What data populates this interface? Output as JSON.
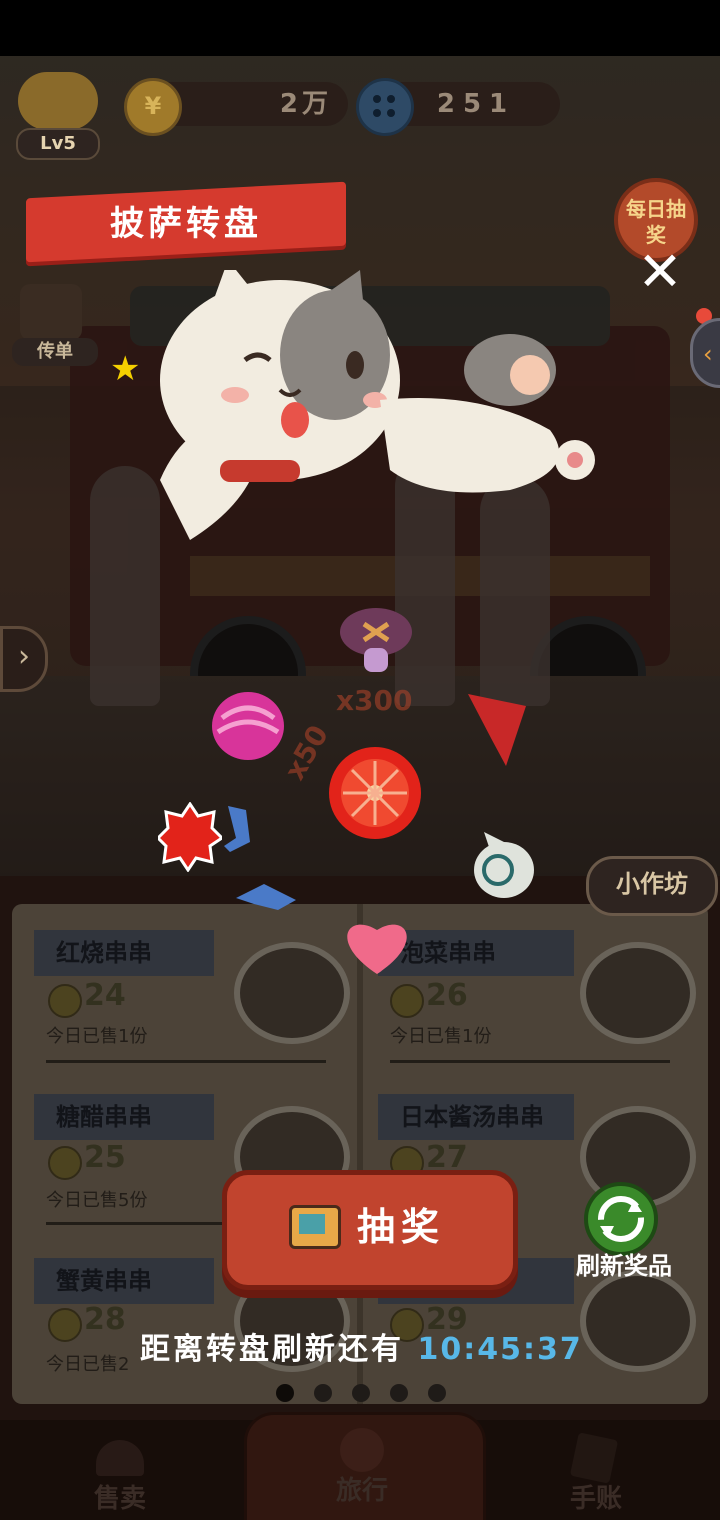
{
  "hud": {
    "level": "Lv5",
    "coins": "2万",
    "buttons": "251"
  },
  "side": {
    "flyer_label": "传单",
    "daily_draw_label": "每日抽奖"
  },
  "wheel": {
    "title": "披萨转盘",
    "multipliers": [
      "x300",
      "x50"
    ]
  },
  "menu": {
    "workshop_label": "小作坊",
    "items": [
      {
        "name": "红烧串串",
        "price": "24",
        "sold": "今日已售1份"
      },
      {
        "name": "泡菜串串",
        "price": "26",
        "sold": "今日已售1份"
      },
      {
        "name": "糖醋串串",
        "price": "25",
        "sold": "今日已售5份"
      },
      {
        "name": "日本酱汤串串",
        "price": "27",
        "sold": ""
      },
      {
        "name": "蟹黄串串",
        "price": "28",
        "sold": "今日已售2"
      },
      {
        "name": "",
        "price": "29",
        "sold": ""
      }
    ]
  },
  "actions": {
    "draw_label": "抽奖",
    "refresh_label": "刷新奖品",
    "countdown_label": "距离转盘刷新还有",
    "countdown_time": "10:45:37"
  },
  "nav": {
    "sell": "售卖",
    "travel": "旅行",
    "ledger": "手账"
  },
  "colors": {
    "banner": "#d53a2e",
    "draw_button": "#c1442e",
    "timer": "#58b8e8",
    "refresh_button": "#3a8a2a"
  }
}
